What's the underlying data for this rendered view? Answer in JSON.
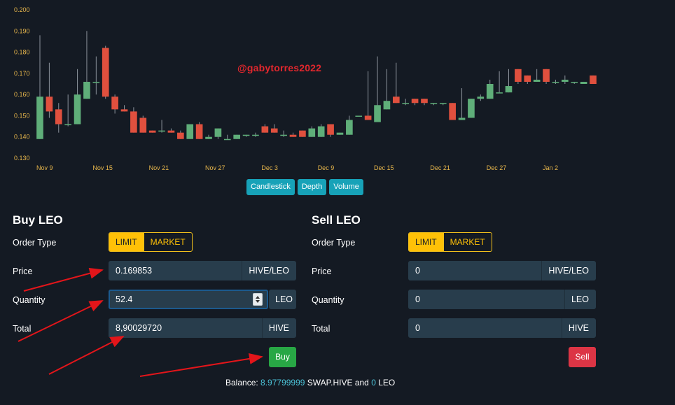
{
  "watermark": "@gabytorres2022",
  "chart_data": {
    "type": "candlestick",
    "x_ticks": [
      "Nov 9",
      "Nov 15",
      "Nov 21",
      "Nov 27",
      "Dec 3",
      "Dec 9",
      "Dec 15",
      "Dec 21",
      "Dec 27",
      "Jan 2"
    ],
    "y_ticks": [
      "0.200",
      "0.190",
      "0.180",
      "0.170",
      "0.160",
      "0.150",
      "0.140",
      "0.130"
    ],
    "ylim": [
      0.13,
      0.2
    ],
    "colors": {
      "up": "#5fae79",
      "down": "#e0503e",
      "axis": "#e8b74c",
      "wick": "#8c939c"
    },
    "candles": [
      {
        "o": 0.139,
        "h": 0.188,
        "l": 0.139,
        "c": 0.159
      },
      {
        "o": 0.159,
        "h": 0.175,
        "l": 0.149,
        "c": 0.152
      },
      {
        "o": 0.153,
        "h": 0.156,
        "l": 0.142,
        "c": 0.146
      },
      {
        "o": 0.146,
        "h": 0.16,
        "l": 0.145,
        "c": 0.146
      },
      {
        "o": 0.146,
        "h": 0.172,
        "l": 0.146,
        "c": 0.16
      },
      {
        "o": 0.158,
        "h": 0.19,
        "l": 0.158,
        "c": 0.166
      },
      {
        "o": 0.166,
        "h": 0.178,
        "l": 0.16,
        "c": 0.166
      },
      {
        "o": 0.182,
        "h": 0.183,
        "l": 0.158,
        "c": 0.159
      },
      {
        "o": 0.159,
        "h": 0.16,
        "l": 0.151,
        "c": 0.153
      },
      {
        "o": 0.153,
        "h": 0.155,
        "l": 0.152,
        "c": 0.152
      },
      {
        "o": 0.152,
        "h": 0.154,
        "l": 0.142,
        "c": 0.142
      },
      {
        "o": 0.149,
        "h": 0.15,
        "l": 0.142,
        "c": 0.142
      },
      {
        "o": 0.143,
        "h": 0.143,
        "l": 0.142,
        "c": 0.142
      },
      {
        "o": 0.143,
        "h": 0.148,
        "l": 0.142,
        "c": 0.143
      },
      {
        "o": 0.143,
        "h": 0.144,
        "l": 0.142,
        "c": 0.142
      },
      {
        "o": 0.142,
        "h": 0.143,
        "l": 0.139,
        "c": 0.139
      },
      {
        "o": 0.139,
        "h": 0.146,
        "l": 0.139,
        "c": 0.146
      },
      {
        "o": 0.146,
        "h": 0.147,
        "l": 0.139,
        "c": 0.139
      },
      {
        "o": 0.139,
        "h": 0.141,
        "l": 0.139,
        "c": 0.14
      },
      {
        "o": 0.14,
        "h": 0.144,
        "l": 0.139,
        "c": 0.144
      },
      {
        "o": 0.139,
        "h": 0.141,
        "l": 0.139,
        "c": 0.139
      },
      {
        "o": 0.139,
        "h": 0.141,
        "l": 0.139,
        "c": 0.141
      },
      {
        "o": 0.141,
        "h": 0.141,
        "l": 0.14,
        "c": 0.141
      },
      {
        "o": 0.141,
        "h": 0.142,
        "l": 0.14,
        "c": 0.141
      },
      {
        "o": 0.145,
        "h": 0.146,
        "l": 0.142,
        "c": 0.142
      },
      {
        "o": 0.144,
        "h": 0.146,
        "l": 0.142,
        "c": 0.142
      },
      {
        "o": 0.141,
        "h": 0.143,
        "l": 0.14,
        "c": 0.141
      },
      {
        "o": 0.141,
        "h": 0.142,
        "l": 0.14,
        "c": 0.14
      },
      {
        "o": 0.143,
        "h": 0.143,
        "l": 0.14,
        "c": 0.14
      },
      {
        "o": 0.14,
        "h": 0.145,
        "l": 0.14,
        "c": 0.144
      },
      {
        "o": 0.14,
        "h": 0.146,
        "l": 0.14,
        "c": 0.145
      },
      {
        "o": 0.146,
        "h": 0.146,
        "l": 0.14,
        "c": 0.141
      },
      {
        "o": 0.141,
        "h": 0.142,
        "l": 0.141,
        "c": 0.142
      },
      {
        "o": 0.141,
        "h": 0.15,
        "l": 0.141,
        "c": 0.148
      },
      {
        "o": 0.15,
        "h": 0.15,
        "l": 0.15,
        "c": 0.15
      },
      {
        "o": 0.15,
        "h": 0.171,
        "l": 0.148,
        "c": 0.148
      },
      {
        "o": 0.147,
        "h": 0.178,
        "l": 0.147,
        "c": 0.155
      },
      {
        "o": 0.153,
        "h": 0.172,
        "l": 0.153,
        "c": 0.157
      },
      {
        "o": 0.159,
        "h": 0.175,
        "l": 0.156,
        "c": 0.156
      },
      {
        "o": 0.156,
        "h": 0.158,
        "l": 0.155,
        "c": 0.156
      },
      {
        "o": 0.158,
        "h": 0.158,
        "l": 0.155,
        "c": 0.156
      },
      {
        "o": 0.158,
        "h": 0.158,
        "l": 0.155,
        "c": 0.156
      },
      {
        "o": 0.156,
        "h": 0.156,
        "l": 0.155,
        "c": 0.156
      },
      {
        "o": 0.156,
        "h": 0.156,
        "l": 0.155,
        "c": 0.156
      },
      {
        "o": 0.156,
        "h": 0.156,
        "l": 0.148,
        "c": 0.148
      },
      {
        "o": 0.148,
        "h": 0.163,
        "l": 0.148,
        "c": 0.149
      },
      {
        "o": 0.149,
        "h": 0.158,
        "l": 0.149,
        "c": 0.158
      },
      {
        "o": 0.158,
        "h": 0.16,
        "l": 0.157,
        "c": 0.159
      },
      {
        "o": 0.158,
        "h": 0.167,
        "l": 0.158,
        "c": 0.165
      },
      {
        "o": 0.161,
        "h": 0.171,
        "l": 0.161,
        "c": 0.161
      },
      {
        "o": 0.161,
        "h": 0.172,
        "l": 0.161,
        "c": 0.164
      },
      {
        "o": 0.172,
        "h": 0.172,
        "l": 0.165,
        "c": 0.166
      },
      {
        "o": 0.169,
        "h": 0.169,
        "l": 0.165,
        "c": 0.166
      },
      {
        "o": 0.166,
        "h": 0.172,
        "l": 0.166,
        "c": 0.167
      },
      {
        "o": 0.172,
        "h": 0.172,
        "l": 0.165,
        "c": 0.166
      },
      {
        "o": 0.166,
        "h": 0.167,
        "l": 0.165,
        "c": 0.166
      },
      {
        "o": 0.166,
        "h": 0.169,
        "l": 0.165,
        "c": 0.167
      },
      {
        "o": 0.166,
        "h": 0.166,
        "l": 0.165,
        "c": 0.166
      },
      {
        "o": 0.165,
        "h": 0.166,
        "l": 0.165,
        "c": 0.166
      },
      {
        "o": 0.169,
        "h": 0.169,
        "l": 0.165,
        "c": 0.165
      }
    ]
  },
  "chart_tabs": [
    "Candlestick",
    "Depth",
    "Volume"
  ],
  "buy": {
    "title": "Buy LEO",
    "order_type_label": "Order Type",
    "limit_label": "LIMIT",
    "market_label": "MARKET",
    "price_label": "Price",
    "price_value": "0.169853",
    "price_unit": "HIVE/LEO",
    "quantity_label": "Quantity",
    "quantity_value": "52.4",
    "quantity_unit": "LEO",
    "total_label": "Total",
    "total_value": "8,90029720",
    "total_unit": "HIVE",
    "button": "Buy"
  },
  "sell": {
    "title": "Sell LEO",
    "order_type_label": "Order Type",
    "limit_label": "LIMIT",
    "market_label": "MARKET",
    "price_label": "Price",
    "price_value": "0",
    "price_unit": "HIVE/LEO",
    "quantity_label": "Quantity",
    "quantity_value": "0",
    "quantity_unit": "LEO",
    "total_label": "Total",
    "total_value": "0",
    "total_unit": "HIVE",
    "button": "Sell"
  },
  "balance": {
    "label": "Balance:",
    "hive_amount": "8.97799999",
    "hive_token": "SWAP.HIVE",
    "and": "and",
    "leo_amount": "0",
    "leo_token": "LEO"
  }
}
